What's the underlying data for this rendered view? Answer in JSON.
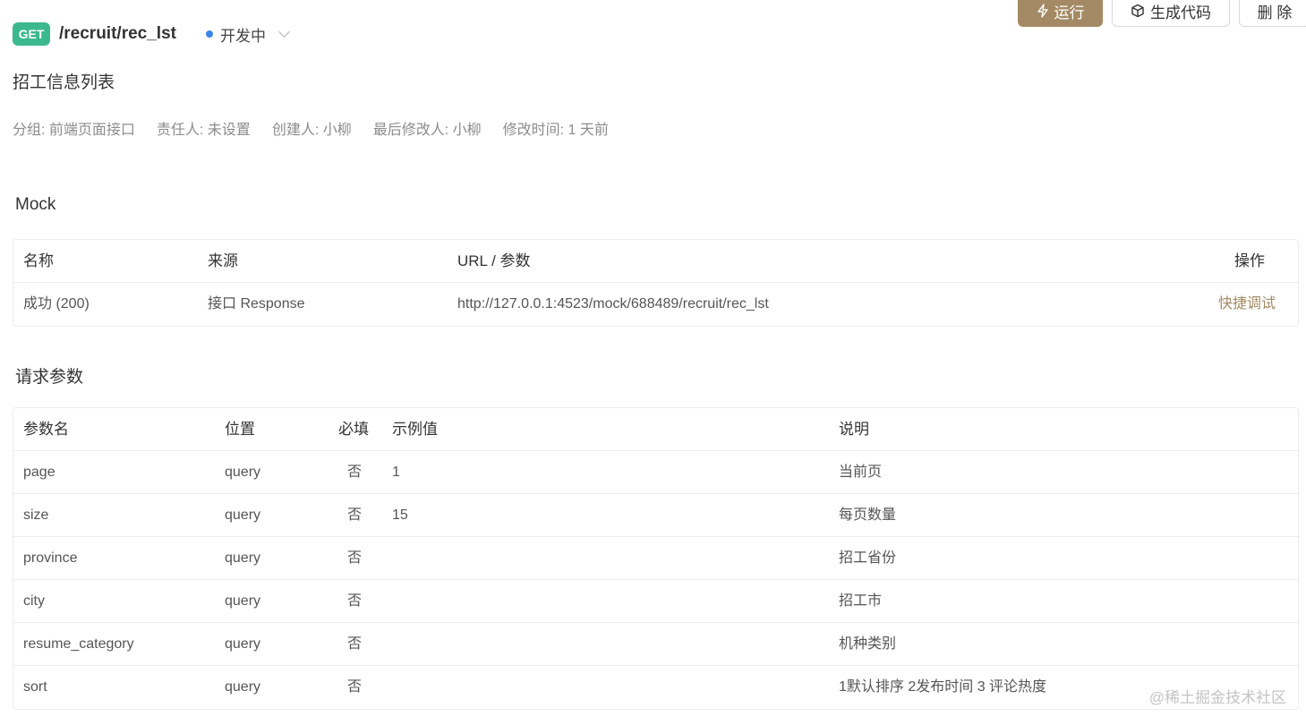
{
  "header": {
    "method": "GET",
    "path": "/recruit/rec_lst",
    "status": "开发中",
    "status_color": "#3a86e8",
    "method_color": "#3cb88e"
  },
  "toolbar": {
    "run_label": "运行",
    "run_icon": "lightning-icon",
    "gen_label": "生成代码",
    "gen_icon": "cube-icon",
    "delete_label": "删 除",
    "accent": "#a38a64"
  },
  "title": "招工信息列表",
  "meta": {
    "group": "分组: 前端页面接口",
    "owner": "责任人: 未设置",
    "creator": "创建人:  小柳",
    "last_modifier": "最后修改人:  小柳",
    "modified": "修改时间: 1 天前"
  },
  "mock": {
    "section_title": "Mock",
    "columns": [
      "名称",
      "来源",
      "URL / 参数",
      "操作"
    ],
    "rows": [
      {
        "name": "成功 (200)",
        "source": "接口 Response",
        "url": "http://127.0.0.1:4523/mock/688489/recruit/rec_lst",
        "action": "快捷调试"
      }
    ]
  },
  "params": {
    "section_title": "请求参数",
    "columns": [
      "参数名",
      "位置",
      "必填",
      "示例值",
      "说明"
    ],
    "rows": [
      {
        "name": "page",
        "in": "query",
        "required": "否",
        "example": "1",
        "desc": "当前页"
      },
      {
        "name": "size",
        "in": "query",
        "required": "否",
        "example": "15",
        "desc": "每页数量"
      },
      {
        "name": "province",
        "in": "query",
        "required": "否",
        "example": "",
        "desc": "招工省份"
      },
      {
        "name": "city",
        "in": "query",
        "required": "否",
        "example": "",
        "desc": "招工市"
      },
      {
        "name": "resume_category",
        "in": "query",
        "required": "否",
        "example": "",
        "desc": "机种类别"
      },
      {
        "name": "sort",
        "in": "query",
        "required": "否",
        "example": "",
        "desc": "1默认排序 2发布时间 3 评论热度"
      }
    ]
  },
  "watermark": "@稀土掘金技术社区"
}
